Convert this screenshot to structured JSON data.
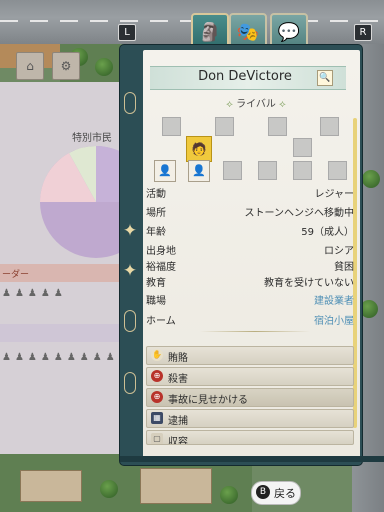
{
  "controls": {
    "left_shoulder": "L",
    "right_shoulder": "R"
  },
  "tabs": [
    {
      "icon": "citizen-portrait-icon",
      "active": true
    },
    {
      "icon": "theater-masks-icon",
      "active": false
    },
    {
      "icon": "speech-bubble-icon",
      "active": false
    }
  ],
  "background_panel": {
    "title": "特別市民",
    "band_label": "ーダー"
  },
  "profile": {
    "name": "Don DeVictore",
    "rival_label": "ライバル",
    "info": [
      {
        "label": "活動",
        "value": "レジャー",
        "link": false
      },
      {
        "label": "場所",
        "value": "ストーンヘンジへ移動中",
        "link": false
      },
      {
        "label": "年齢",
        "value": "59（成人）",
        "link": false
      },
      {
        "label": "出身地",
        "value": "ロシア",
        "link": false
      },
      {
        "label": "裕福度",
        "value": "貧困",
        "link": false
      },
      {
        "label": "教育",
        "value": "教育を受けていない",
        "link": false
      },
      {
        "label": "職場",
        "value": "建設業者",
        "link": true
      },
      {
        "label": "ホーム",
        "value": "宿泊小屋",
        "link": true
      }
    ],
    "actions": [
      {
        "label": "賄賂",
        "icon": "bribe-icon"
      },
      {
        "label": "殺害",
        "icon": "kill-icon"
      },
      {
        "label": "事故に見せかける",
        "icon": "accident-icon"
      },
      {
        "label": "逮捕",
        "icon": "arrest-icon"
      },
      {
        "label": "収容",
        "icon": "detain-icon"
      }
    ]
  },
  "footer": {
    "button_glyph": "B",
    "back_label": "戻る"
  },
  "colors": {
    "card_frame": "#2c4e55",
    "link": "#4f8fb5",
    "scroll_accent": "#e8d27a"
  }
}
